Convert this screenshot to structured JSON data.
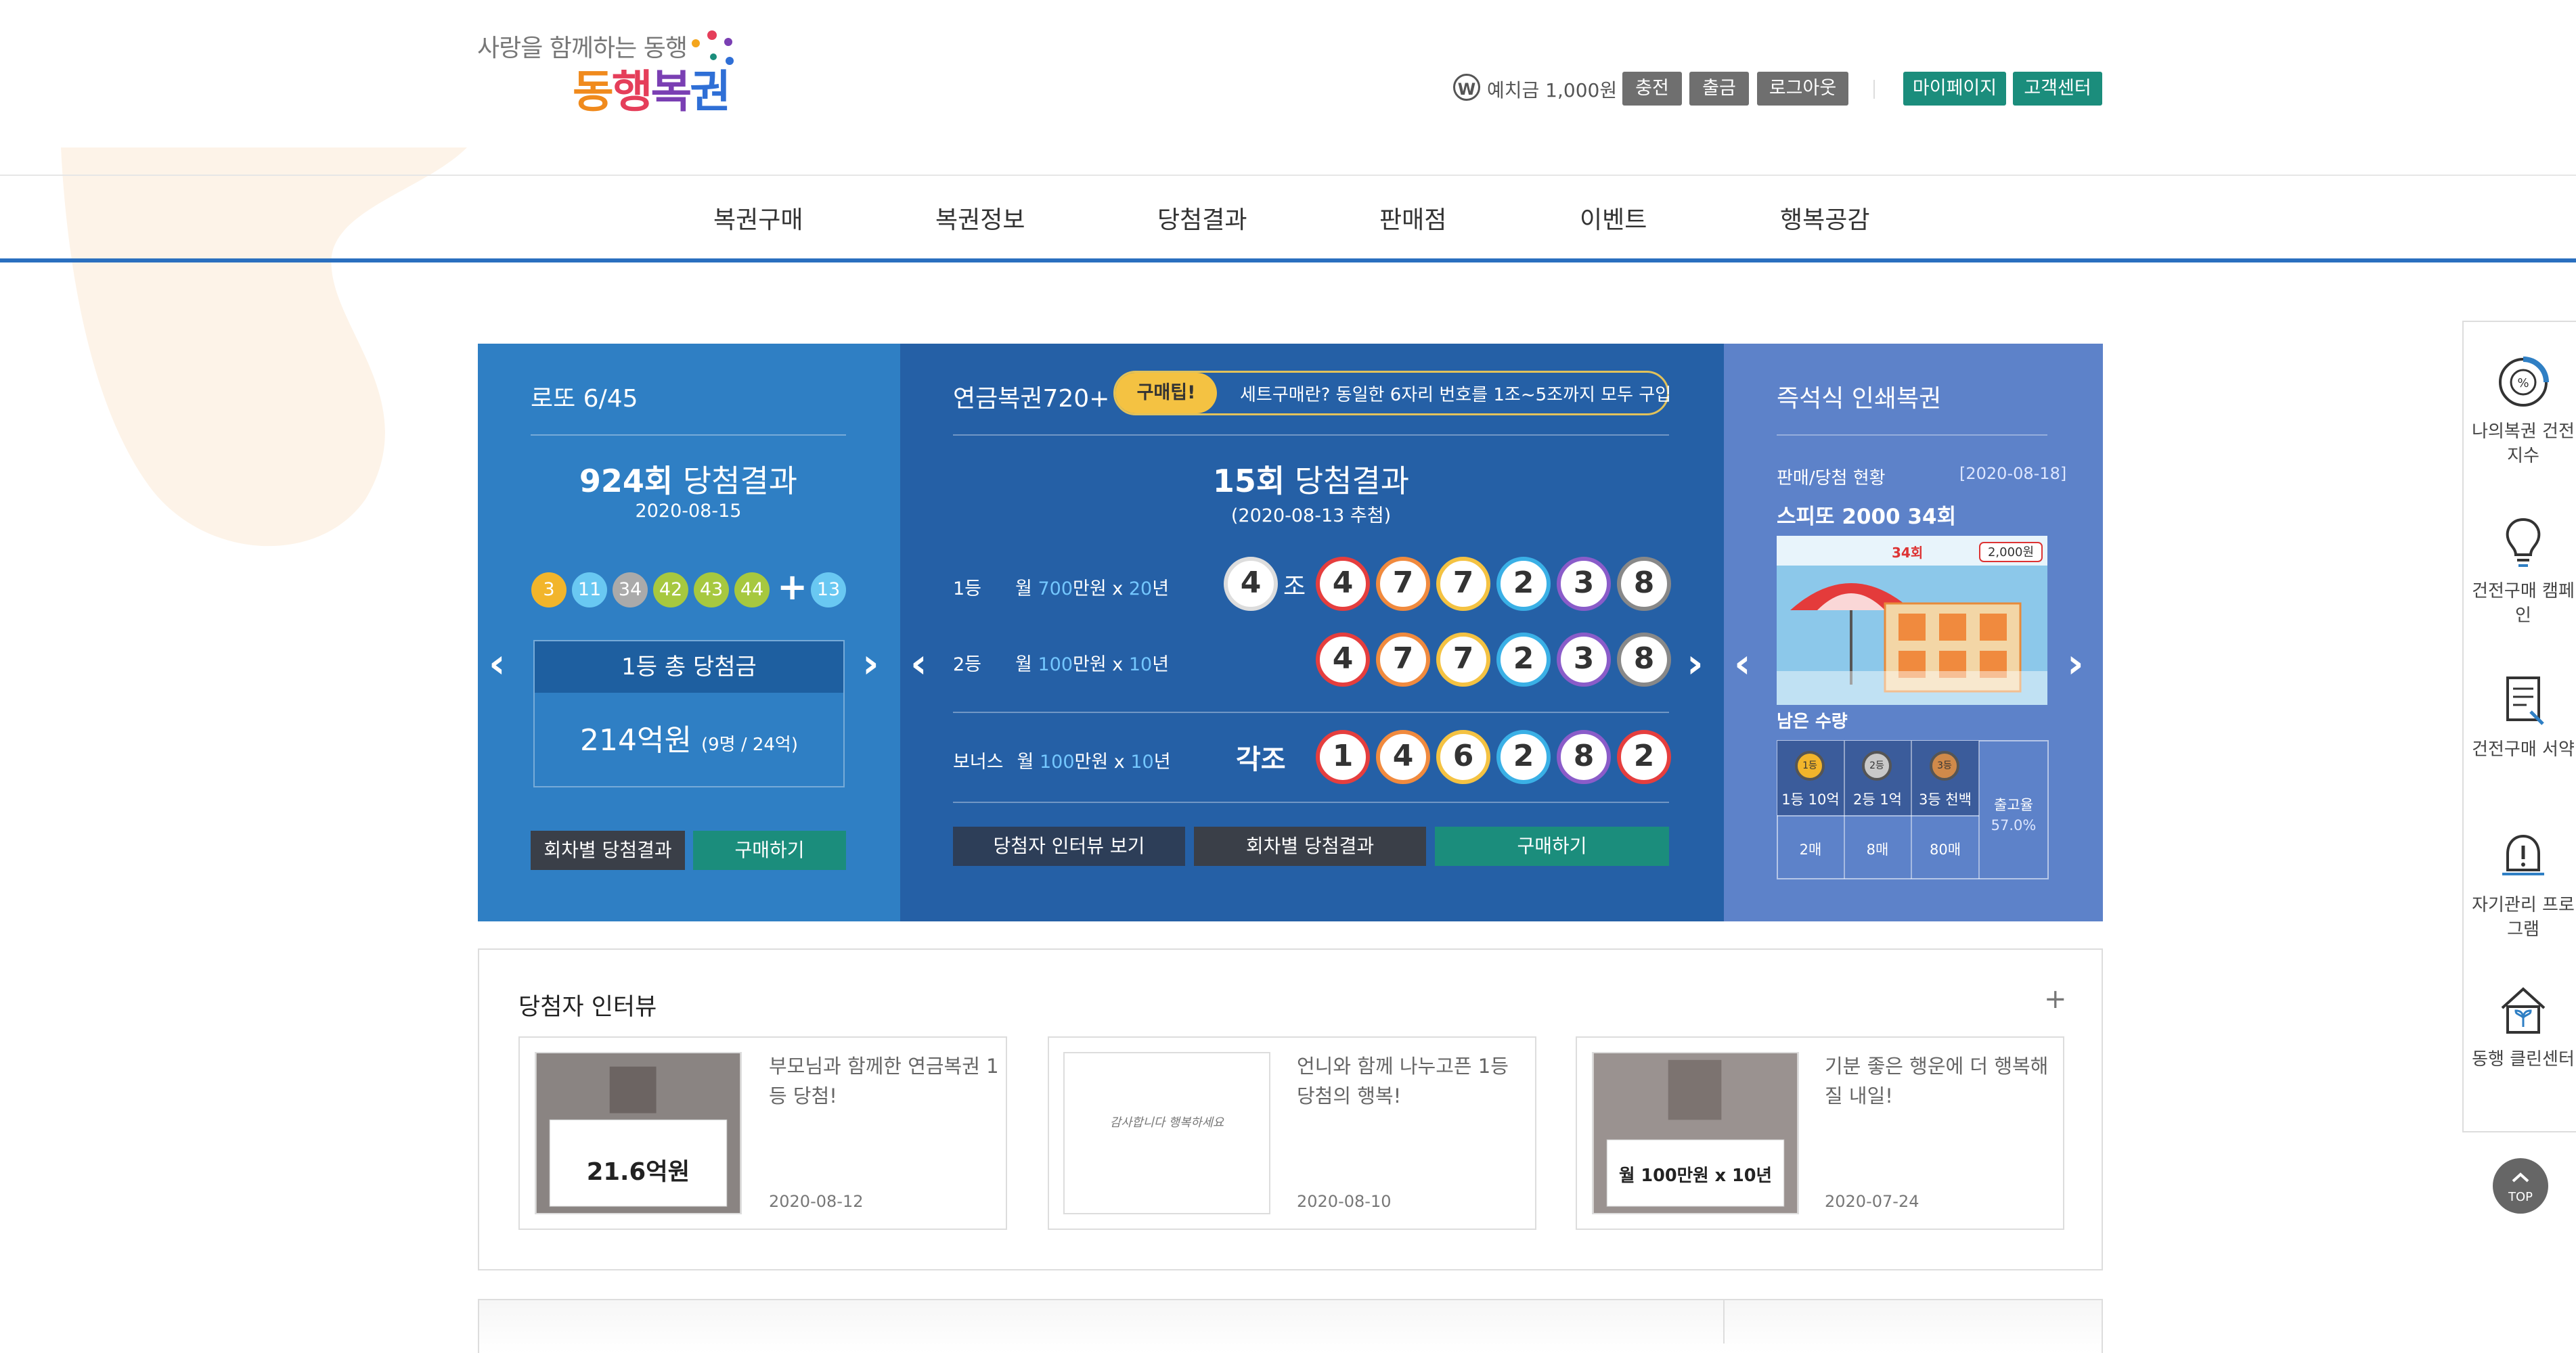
{
  "header": {
    "tagline": "사랑을 함께하는 동행",
    "logo": [
      "동",
      "행",
      "복",
      "권"
    ],
    "deposit_icon": "W",
    "deposit": "예치금 1,000원",
    "buttons": [
      "충전",
      "출금",
      "로그아웃"
    ],
    "user_buttons": [
      "마이페이지",
      "고객센터"
    ]
  },
  "nav": [
    "복권구매",
    "복권정보",
    "당첨결과",
    "판매점",
    "이벤트",
    "행복공감"
  ],
  "lotto": {
    "title": "로또 6/45",
    "round_num": "924회",
    "round_suffix": "당첨결과",
    "date": "2020-08-15",
    "balls": [
      "3",
      "11",
      "34",
      "42",
      "43",
      "44"
    ],
    "plus": "+",
    "bonus": "13",
    "total_label": "1등 총 당첨금",
    "amount": "214억원",
    "amount_sub": "(9명 / 24억)",
    "btn_history": "회차별 당첨결과",
    "btn_buy": "구매하기"
  },
  "pension": {
    "title": "연금복권720+",
    "tip_badge": "구매팁!",
    "tip_text": "세트구매란? 동일한 6자리 번호를 1조~5조까지 모두 구입",
    "round_num": "15회",
    "round_suffix": "당첨결과",
    "date": "(2020-08-13 추첨)",
    "rows": [
      {
        "rank": "1등",
        "pre": "월 ",
        "amt": "700",
        "mid": "만원 x ",
        "yrs": "20",
        "post": "년"
      },
      {
        "rank": "2등",
        "pre": "월 ",
        "amt": "100",
        "mid": "만원 x ",
        "yrs": "10",
        "post": "년"
      },
      {
        "rank": "보너스",
        "pre": "월 ",
        "amt": "100",
        "mid": "만원 x ",
        "yrs": "10",
        "post": "년"
      }
    ],
    "group_num": "4",
    "group_label": "조",
    "first": [
      "4",
      "7",
      "7",
      "2",
      "3",
      "8"
    ],
    "second": [
      "4",
      "7",
      "7",
      "2",
      "3",
      "8"
    ],
    "bonus_label": "각조",
    "bonus": [
      "1",
      "4",
      "6",
      "2",
      "8",
      "2"
    ],
    "btn_interview": "당첨자 인터뷰 보기",
    "btn_history": "회차별 당첨결과",
    "btn_buy": "구매하기"
  },
  "instant": {
    "title": "즉석식 인쇄복권",
    "status_label": "판매/당첨 현황",
    "status_date": "[2020-08-18]",
    "product": "스피또 2000 34회",
    "ticket_round": "34회",
    "ticket_price": "2,000원",
    "remain_label": "남은 수량",
    "prizes": [
      {
        "medal": "1등",
        "label": "1등 10억",
        "count": "2매"
      },
      {
        "medal": "2등",
        "label": "2등 1억",
        "count": "8매"
      },
      {
        "medal": "3등",
        "label": "3등 천백",
        "count": "80매"
      }
    ],
    "ship_label": "출고율",
    "ship_value": "57.0%"
  },
  "interview": {
    "title": "당첨자 인터뷰",
    "more": "+",
    "cards": [
      {
        "text": "부모님과 함께한 연금복권 1등 당첨!",
        "date": "2020-08-12",
        "amount": "21.6억원"
      },
      {
        "text": "언니와 함께 나누고픈 1등 당첨의 행복!",
        "date": "2020-08-10",
        "handwriting": "감사합니다 행복하세요"
      },
      {
        "text": "기분 좋은 행운에 더 행복해질 내일!",
        "date": "2020-07-24",
        "amount": "월 100만원 x 10년"
      }
    ]
  },
  "sidebar": [
    {
      "icon": "gauge-icon",
      "label": "나의복권 건전지수"
    },
    {
      "icon": "lightbulb-icon",
      "label": "건전구매 캠페인"
    },
    {
      "icon": "document-icon",
      "label": "건전구매 서약"
    },
    {
      "icon": "alert-icon",
      "label": "자기관리 프로그램"
    },
    {
      "icon": "house-plant-icon",
      "label": "동행 클린센터"
    }
  ],
  "top_button": "TOP",
  "colors": {
    "teal": "#1b8d7c",
    "lotto_blue": "#2f7fc4",
    "pension_blue": "#2560a6",
    "instant_blue": "#5d82c9"
  }
}
